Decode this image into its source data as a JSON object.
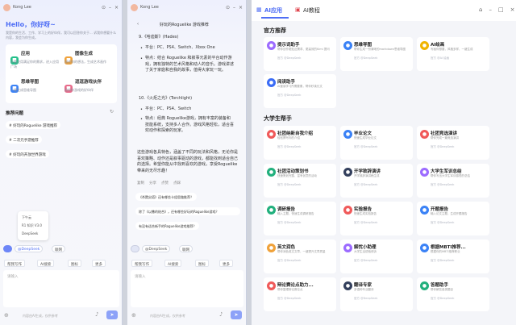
{
  "left_window": {
    "user": "Kong Lee",
    "greeting": "Hello，你好呀~",
    "intro": "我是你的生活、工作、学习上的好伙伴，我可以回答你关于... 诉我你想要什么内容，我会为你生成。",
    "features": [
      {
        "title": "应用",
        "desc": "丰富应用满足你的需求，进入应用广场",
        "icon": "apps-icon",
        "color": "#22c08a"
      },
      {
        "title": "图像生成",
        "desc": "描述你的想法，生成艺术画作",
        "icon": "image-icon",
        "color": "#f0a23a"
      },
      {
        "title": "思维导图",
        "desc": "一键生成思维导图",
        "icon": "mindmap-icon",
        "color": "#3b82f6"
      },
      {
        "title": "逗逗游戏伙伴",
        "desc": "陪伴你游戏的好伙伴",
        "icon": "game-icon",
        "color": "#e86a8a"
      }
    ],
    "recommend_title": "推荐问题",
    "suggestions": [
      "# 好玩的Roguelike 游戏推荐",
      "# 二次元手游推荐",
      "# 好玩的开放世界游戏"
    ],
    "model_popup": [
      "下午云",
      "R1 知识 V3.0",
      "DeepSeek"
    ],
    "chips": [
      "@DeepSeek",
      "联网"
    ],
    "tools": [
      "帮我写作",
      "AI搜索",
      "图标",
      "更多"
    ],
    "input_placeholder": "请输入",
    "footer": "内容由AI生成，仅供参考"
  },
  "middle_window": {
    "user": "Kong Lee",
    "user_message": "好玩的Roguelike 游戏推荐",
    "item9_title": "9.《哈迪斯》(Hades)",
    "item9_platform": "平台：PC、PS4、Switch、Xbox One",
    "item9_feature": "特点：结合 Roguelike 和叙事元素的平台动作游戏，拥有独特的艺术风格和动人的音乐。游戏讲述了关于家庭和自我的故事，值得大家玩一玩。",
    "item10_title": "10.《火炬之光》(Torchlight)",
    "item10_platform": "平台：PC、PS4、Switch",
    "item10_feature": "特点：经典 Roguelike游戏，拥有丰富的装备和技能系统，支持多人合作。游戏风格轻松，适合喜欢动作和探索的玩家。",
    "summary": "这些游戏各具特色，涵盖了不同的玩法和风格，无论你是喜欢策略、动作还是叙事驱动的游戏，都能找到适合自己的选择。希望你能从中找到喜欢的游戏，享受Roguelike带来的无尽乐趣！",
    "actions": [
      "复制",
      "分享",
      "点赞",
      "点踩"
    ],
    "followups": [
      "《杀戮尖塔》还有哪些卡组思路推荐？",
      "除了《以撒的结合》，还有哪些好玩的Roguelike游戏？",
      "有没有适合新手的Roguelike游戏推荐？"
    ],
    "chips": [
      "@DeepSeek",
      "联网"
    ],
    "tools": [
      "帮我写作",
      "AI搜索",
      "图标",
      "更多"
    ],
    "input_placeholder": "请输入",
    "footer": "内容由AI生成，仅供参考"
  },
  "right_window": {
    "tabs": [
      "AI应用",
      "AI教程"
    ],
    "section1": "官方推荐",
    "official": [
      {
        "name": "提示词助手",
        "desc": "帮你创作更贴近需求、更高效的Kimi 提问",
        "badge": "官方 @DeepSeek",
        "icon": "prompt-icon",
        "color": "#9c6bff"
      },
      {
        "name": "思维导图",
        "desc": "帮你生成一份清晰的markdown思维导图",
        "badge": "官方 @DeepSeek",
        "icon": "mindmap-icon",
        "color": "#3b82f6"
      },
      {
        "name": "AI绘画",
        "desc": "写画你想要，风格多样，一键生成",
        "badge": "官方 @AI 绘画",
        "icon": "paint-icon",
        "color": "#f0b400"
      },
      {
        "name": "阅读助手",
        "desc": "AI速读学习所需要素，帮你秒读长文",
        "badge": "官方 @DeepSeek",
        "icon": "read-icon",
        "color": "#3b6cf6"
      }
    ],
    "section2": "大学生帮手",
    "student": [
      {
        "name": "社团纳新自我介绍",
        "desc": "轻松撰写你的介绍",
        "badge": "官方 @DeepSeek",
        "icon": "intro-icon",
        "color": "#f05a5a"
      },
      {
        "name": "毕业论文",
        "desc": "快速生成毕业论文",
        "badge": "官方 @DeepSeek",
        "icon": "thesis-icon",
        "color": "#3b82f6"
      },
      {
        "name": "社团竞选演讲",
        "desc": "帮你完成一篇竞选演讲",
        "badge": "官方 @DeepSeek",
        "icon": "speech-icon",
        "color": "#f05a5a"
      },
      {
        "name": "社团活动策划书",
        "desc": "快速策划完整、富有创意的活动",
        "badge": "官方 @DeepSeek",
        "icon": "plan-icon",
        "color": "#22b07d"
      },
      {
        "name": "开学致辞演讲",
        "desc": "开学致辞演讲稿生成",
        "badge": "官方 @DeepSeek",
        "icon": "speech2-icon",
        "color": "#333f5c"
      },
      {
        "name": "大学生军训总结",
        "desc": "帮你写出大学生军训感悟的总结",
        "badge": "官方 @DeepSeek",
        "icon": "summary-icon",
        "color": "#9c6bff"
      },
      {
        "name": "调研报告",
        "desc": "输入主题，快速生成调研报告",
        "badge": "官方 @DeepSeek",
        "icon": "research-icon",
        "color": "#22b07d"
      },
      {
        "name": "实验报告",
        "desc": "快速生成实验报告",
        "badge": "官方 @DeepSeek",
        "icon": "lab-icon",
        "color": "#f05a5a"
      },
      {
        "name": "开题报告",
        "desc": "输入论文主题，生成开题报告",
        "badge": "官方 @DeepSeek",
        "icon": "proposal-icon",
        "color": "#3b82f6"
      },
      {
        "name": "英文润色",
        "desc": "帮你润色英文文章，一键提升文章质量",
        "badge": "官方 @DeepSeek",
        "icon": "english-icon",
        "color": "#f0a23a"
      },
      {
        "name": "解忧小助理",
        "desc": "大学生活烦恼倾诉",
        "badge": "官方 @DeepSeek",
        "icon": "helper-icon",
        "color": "#9c6bff"
      },
      {
        "name": "根据MBTI推荐...",
        "desc": "根据你的MBTI推荐职业",
        "badge": "官方 @DeepSeek",
        "icon": "mbti-icon",
        "color": "#3b82f6"
      },
      {
        "name": "辩论赛论点助力...",
        "desc": "帮你整理辩论赛论点",
        "badge": "官方 @DeepSeek",
        "icon": "debate-icon",
        "color": "#f05a5a"
      },
      {
        "name": "翻译专家",
        "desc": "多语种专业翻译",
        "badge": "官方 @DeepSeek",
        "icon": "translate-icon",
        "color": "#333f5c"
      },
      {
        "name": "答题助手",
        "desc": "帮你解答各类题目",
        "badge": "官方 @DeepSeek",
        "icon": "answer-icon",
        "color": "#22b07d"
      }
    ]
  }
}
